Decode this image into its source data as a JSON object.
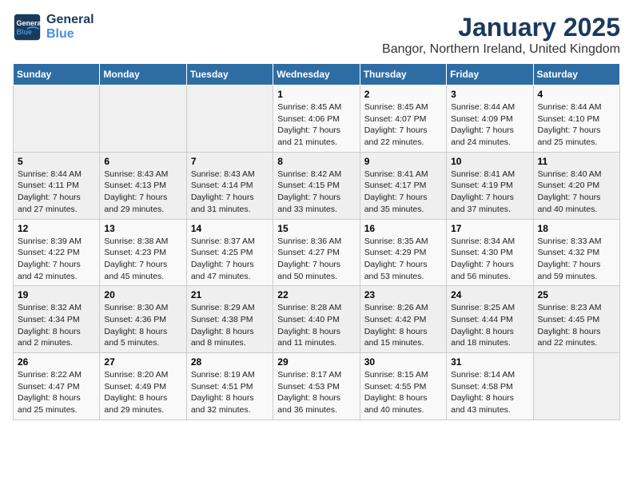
{
  "logo": {
    "line1": "General",
    "line2": "Blue"
  },
  "title": "January 2025",
  "subtitle": "Bangor, Northern Ireland, United Kingdom",
  "weekdays": [
    "Sunday",
    "Monday",
    "Tuesday",
    "Wednesday",
    "Thursday",
    "Friday",
    "Saturday"
  ],
  "weeks": [
    [
      {
        "day": "",
        "info": ""
      },
      {
        "day": "",
        "info": ""
      },
      {
        "day": "",
        "info": ""
      },
      {
        "day": "1",
        "info": "Sunrise: 8:45 AM\nSunset: 4:06 PM\nDaylight: 7 hours and 21 minutes."
      },
      {
        "day": "2",
        "info": "Sunrise: 8:45 AM\nSunset: 4:07 PM\nDaylight: 7 hours and 22 minutes."
      },
      {
        "day": "3",
        "info": "Sunrise: 8:44 AM\nSunset: 4:09 PM\nDaylight: 7 hours and 24 minutes."
      },
      {
        "day": "4",
        "info": "Sunrise: 8:44 AM\nSunset: 4:10 PM\nDaylight: 7 hours and 25 minutes."
      }
    ],
    [
      {
        "day": "5",
        "info": "Sunrise: 8:44 AM\nSunset: 4:11 PM\nDaylight: 7 hours and 27 minutes."
      },
      {
        "day": "6",
        "info": "Sunrise: 8:43 AM\nSunset: 4:13 PM\nDaylight: 7 hours and 29 minutes."
      },
      {
        "day": "7",
        "info": "Sunrise: 8:43 AM\nSunset: 4:14 PM\nDaylight: 7 hours and 31 minutes."
      },
      {
        "day": "8",
        "info": "Sunrise: 8:42 AM\nSunset: 4:15 PM\nDaylight: 7 hours and 33 minutes."
      },
      {
        "day": "9",
        "info": "Sunrise: 8:41 AM\nSunset: 4:17 PM\nDaylight: 7 hours and 35 minutes."
      },
      {
        "day": "10",
        "info": "Sunrise: 8:41 AM\nSunset: 4:19 PM\nDaylight: 7 hours and 37 minutes."
      },
      {
        "day": "11",
        "info": "Sunrise: 8:40 AM\nSunset: 4:20 PM\nDaylight: 7 hours and 40 minutes."
      }
    ],
    [
      {
        "day": "12",
        "info": "Sunrise: 8:39 AM\nSunset: 4:22 PM\nDaylight: 7 hours and 42 minutes."
      },
      {
        "day": "13",
        "info": "Sunrise: 8:38 AM\nSunset: 4:23 PM\nDaylight: 7 hours and 45 minutes."
      },
      {
        "day": "14",
        "info": "Sunrise: 8:37 AM\nSunset: 4:25 PM\nDaylight: 7 hours and 47 minutes."
      },
      {
        "day": "15",
        "info": "Sunrise: 8:36 AM\nSunset: 4:27 PM\nDaylight: 7 hours and 50 minutes."
      },
      {
        "day": "16",
        "info": "Sunrise: 8:35 AM\nSunset: 4:29 PM\nDaylight: 7 hours and 53 minutes."
      },
      {
        "day": "17",
        "info": "Sunrise: 8:34 AM\nSunset: 4:30 PM\nDaylight: 7 hours and 56 minutes."
      },
      {
        "day": "18",
        "info": "Sunrise: 8:33 AM\nSunset: 4:32 PM\nDaylight: 7 hours and 59 minutes."
      }
    ],
    [
      {
        "day": "19",
        "info": "Sunrise: 8:32 AM\nSunset: 4:34 PM\nDaylight: 8 hours and 2 minutes."
      },
      {
        "day": "20",
        "info": "Sunrise: 8:30 AM\nSunset: 4:36 PM\nDaylight: 8 hours and 5 minutes."
      },
      {
        "day": "21",
        "info": "Sunrise: 8:29 AM\nSunset: 4:38 PM\nDaylight: 8 hours and 8 minutes."
      },
      {
        "day": "22",
        "info": "Sunrise: 8:28 AM\nSunset: 4:40 PM\nDaylight: 8 hours and 11 minutes."
      },
      {
        "day": "23",
        "info": "Sunrise: 8:26 AM\nSunset: 4:42 PM\nDaylight: 8 hours and 15 minutes."
      },
      {
        "day": "24",
        "info": "Sunrise: 8:25 AM\nSunset: 4:44 PM\nDaylight: 8 hours and 18 minutes."
      },
      {
        "day": "25",
        "info": "Sunrise: 8:23 AM\nSunset: 4:45 PM\nDaylight: 8 hours and 22 minutes."
      }
    ],
    [
      {
        "day": "26",
        "info": "Sunrise: 8:22 AM\nSunset: 4:47 PM\nDaylight: 8 hours and 25 minutes."
      },
      {
        "day": "27",
        "info": "Sunrise: 8:20 AM\nSunset: 4:49 PM\nDaylight: 8 hours and 29 minutes."
      },
      {
        "day": "28",
        "info": "Sunrise: 8:19 AM\nSunset: 4:51 PM\nDaylight: 8 hours and 32 minutes."
      },
      {
        "day": "29",
        "info": "Sunrise: 8:17 AM\nSunset: 4:53 PM\nDaylight: 8 hours and 36 minutes."
      },
      {
        "day": "30",
        "info": "Sunrise: 8:15 AM\nSunset: 4:55 PM\nDaylight: 8 hours and 40 minutes."
      },
      {
        "day": "31",
        "info": "Sunrise: 8:14 AM\nSunset: 4:58 PM\nDaylight: 8 hours and 43 minutes."
      },
      {
        "day": "",
        "info": ""
      }
    ]
  ]
}
